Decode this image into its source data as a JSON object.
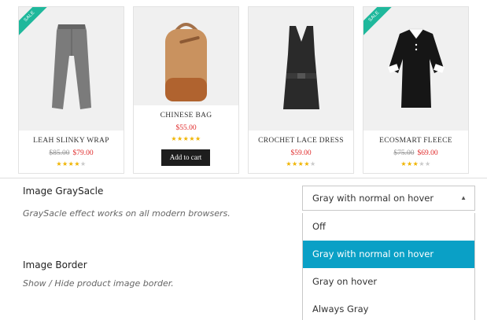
{
  "products": [
    {
      "name": "Leah Slinky Wrap",
      "old_price": "$85.00",
      "price": "$79.00",
      "sale": "SALE",
      "rating": 4,
      "max_rating": 5
    },
    {
      "name": "Chinese Bag",
      "price": "$55.00",
      "rating": 5,
      "max_rating": 5,
      "button": "Add to cart"
    },
    {
      "name": "Crochet Lace Dress",
      "price": "$59.00",
      "rating": 4,
      "max_rating": 5
    },
    {
      "name": "Ecosmart Fleece",
      "old_price": "$75.00",
      "price": "$69.00",
      "sale": "SALE",
      "rating": 3,
      "max_rating": 5
    }
  ],
  "settings": {
    "grayscale": {
      "label": "Image GraySacle",
      "description": "GraySacle effect works on all modern browsers.",
      "selected": "Gray with normal on hover",
      "options": [
        "Off",
        "Gray with normal on hover",
        "Gray on hover",
        "Always Gray"
      ],
      "highlighted_index": 1
    },
    "border": {
      "label": "Image Border",
      "description": "Show / Hide product image border."
    }
  },
  "icons": {
    "dropdown_arrow": "triangle-up-icon",
    "star": "star-icon"
  },
  "colors": {
    "sale_badge": "#1fb89c",
    "price": "#e02b2b",
    "star": "#f0b400",
    "option_highlight": "#0aa0c6",
    "button": "#1d1d1d"
  }
}
